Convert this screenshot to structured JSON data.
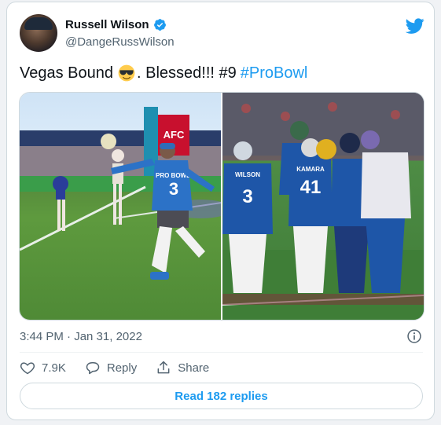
{
  "author": {
    "display_name": "Russell Wilson",
    "handle": "@DangeRussWilson",
    "verified": true
  },
  "tweet": {
    "text_before_emoji": "Vegas Bound",
    "emoji": "smiling-face-with-sunglasses",
    "text_after_emoji": ". Blessed!!! #9",
    "hashtag": "#ProBowl"
  },
  "media": {
    "left_photo": {
      "banner": "AFC",
      "jersey_text": "PRO BOWL",
      "jersey_number": "3"
    },
    "right_photo": {
      "jersey_name_1": "WILSON",
      "jersey_number_1": "3",
      "jersey_name_2": "KAMARA",
      "jersey_number_2": "41"
    }
  },
  "meta": {
    "timestamp": "3:44 PM · Jan 31, 2022"
  },
  "actions": {
    "likes": "7.9K",
    "reply_label": "Reply",
    "share_label": "Share"
  },
  "footer": {
    "read_replies_label": "Read 182 replies"
  },
  "colors": {
    "accent": "#1d9bf0",
    "secondary_text": "#536471",
    "border": "#cfd9de"
  },
  "icons": [
    "verified-badge-icon",
    "twitter-bird-icon",
    "heart-icon",
    "reply-icon",
    "share-icon",
    "info-icon"
  ]
}
